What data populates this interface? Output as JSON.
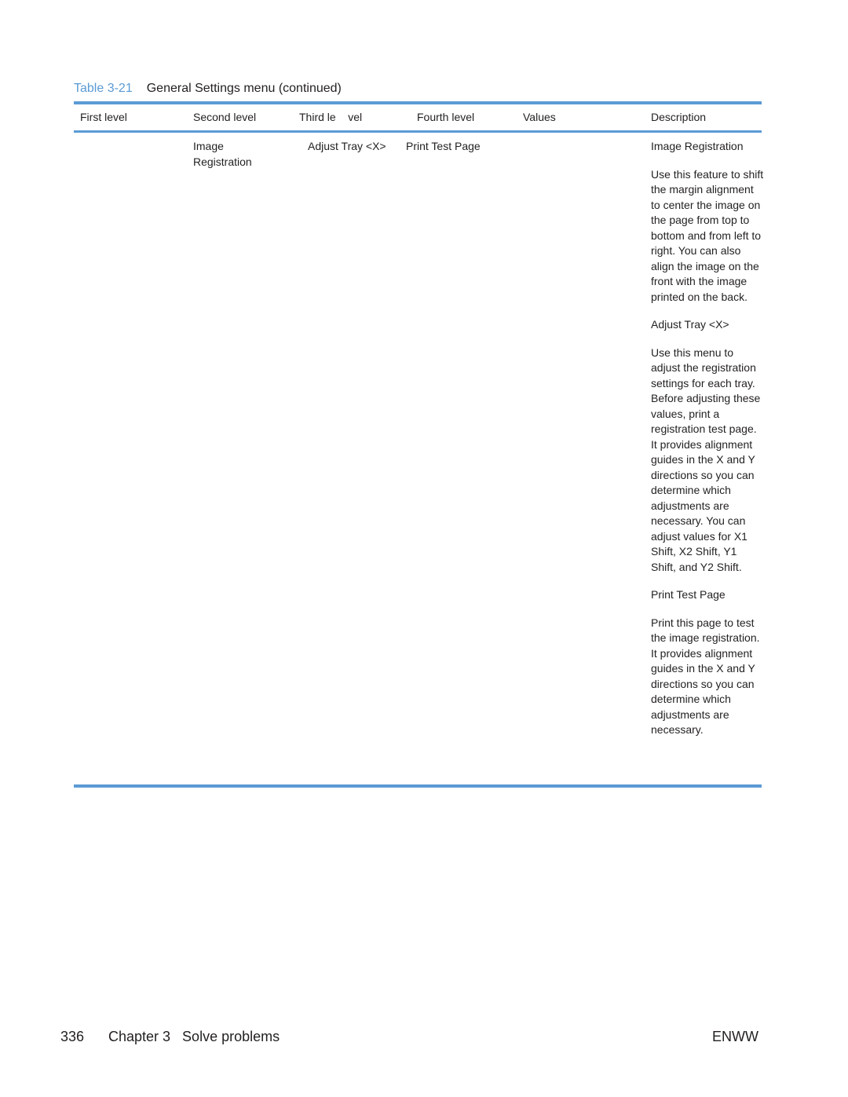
{
  "caption": {
    "number": "Table 3-21",
    "title": "General Settings menu (continued)"
  },
  "colors": {
    "accent": "#5b9bd5",
    "text": "#231f20"
  },
  "table": {
    "headers": [
      "First level",
      "Second level",
      "Third le    vel",
      "Fourth level",
      "Values",
      "Description"
    ],
    "row": {
      "first_level": "",
      "second_level": "Image Registration",
      "third_level": "Adjust Tray <X>",
      "fourth_level": "Print Test Page",
      "values": "",
      "description": [
        "Image Registration",
        "Use this feature to shift the margin alignment to center the image on the page from top to bottom and from left to right. You can also align the image on the front with the image printed on the back.",
        "Adjust Tray <X>",
        "Use this menu to adjust the registration settings for each tray. Before adjusting these values, print a registration test page. It provides alignment guides in the X and Y directions so you can determine which adjustments are necessary. You can adjust values for X1 Shift, X2 Shift, Y1 Shift, and Y2 Shift.",
        "Print Test Page",
        "Print this page to test the image registration. It provides alignment guides in the X and Y directions so you can determine which adjustments are necessary."
      ]
    }
  },
  "footer": {
    "page_number": "336",
    "chapter": "Chapter 3   Solve problems",
    "label": "ENWW"
  }
}
